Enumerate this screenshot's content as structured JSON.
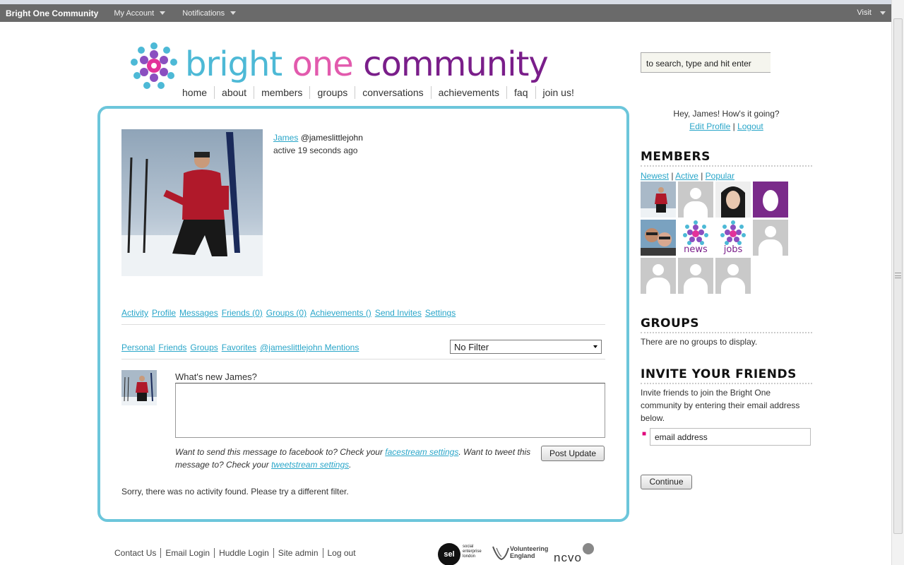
{
  "adminbar": {
    "brand": "Bright One Community",
    "menus": [
      "My Account",
      "Notifications"
    ],
    "visit": "Visit"
  },
  "logo": {
    "word1": "bright",
    "word2": "one",
    "word3": "community"
  },
  "nav": [
    "home",
    "about",
    "members",
    "groups",
    "conversations",
    "achievements",
    "faq",
    "join us!"
  ],
  "search": {
    "placeholder": "to search, type and hit enter"
  },
  "profile": {
    "name": "James",
    "handle": "@jameslittlejohn",
    "activity": "active 19 seconds ago"
  },
  "profile_tabs": [
    "Activity",
    "Profile",
    "Messages",
    "Friends (0)",
    "Groups (0)",
    "Achievements ()",
    "Send Invites",
    "Settings"
  ],
  "activity_tabs": [
    "Personal",
    "Friends",
    "Groups",
    "Favorites",
    "@jameslittlejohn Mentions"
  ],
  "filter": {
    "selected": "No Filter"
  },
  "post": {
    "label": "What's new James?",
    "note_1": "Want to send this message to facebook to? Check your",
    "facestream_link": "facestream settings",
    "note_2": ". Want to tweet this message to? Check your",
    "tweetstream_link": "tweetstream settings",
    "note_3": ".",
    "button": "Post Update"
  },
  "no_activity": "Sorry, there was no activity found. Please try a different filter.",
  "sidebar": {
    "greeting": "Hey, James! How's it going?",
    "edit_profile": "Edit Profile",
    "sep": "|",
    "logout": "Logout",
    "members_heading": "MEMBERS",
    "members_links": [
      "Newest",
      "Active",
      "Popular"
    ],
    "tile_news": "news",
    "tile_jobs": "jobs",
    "groups_heading": "GROUPS",
    "groups_empty": "There are no groups to display.",
    "invite_heading": "INVITE YOUR FRIENDS",
    "invite_text": "Invite friends to join the Bright One community by entering their email address below.",
    "email_value": "email address",
    "continue": "Continue"
  },
  "footer": [
    "Contact Us",
    "Email Login",
    "Huddle Login",
    "Site admin",
    "Log out"
  ],
  "sponsors": {
    "sel": "sel",
    "sel_sub": "social enterprise london",
    "ve": "Volunteering England",
    "ncvo": "ncvo"
  },
  "colors": {
    "accent": "#6cc6db",
    "pink": "#e25aad",
    "purple": "#7a1e8a",
    "link": "#2aa6c9"
  }
}
